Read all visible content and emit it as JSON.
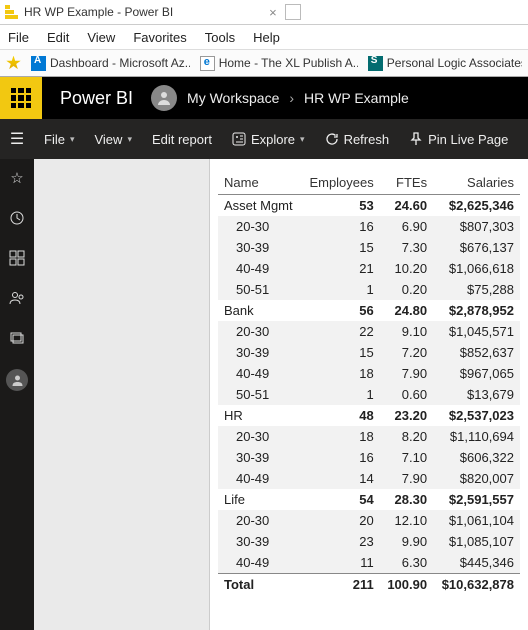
{
  "window": {
    "title": "HR WP Example - Power BI"
  },
  "menu": [
    "File",
    "Edit",
    "View",
    "Favorites",
    "Tools",
    "Help"
  ],
  "favorites": [
    {
      "icon": "azure",
      "label": "Dashboard - Microsoft Az..."
    },
    {
      "icon": "excel",
      "label": "Home - The XL Publish A..."
    },
    {
      "icon": "sharepoint",
      "label": "Personal Logic Associates"
    }
  ],
  "pbi": {
    "product": "Power BI",
    "workspace": "My Workspace",
    "report": "HR WP Example"
  },
  "actions": {
    "file": "File",
    "view": "View",
    "edit": "Edit report",
    "explore": "Explore",
    "refresh": "Refresh",
    "pin": "Pin Live Page"
  },
  "table": {
    "headers": [
      "Name",
      "Employees",
      "FTEs",
      "Salaries"
    ],
    "rows": [
      {
        "t": "g",
        "n": "Asset Mgmt",
        "e": "53",
        "f": "24.60",
        "s": "$2,625,346"
      },
      {
        "t": "s",
        "n": "20-30",
        "e": "16",
        "f": "6.90",
        "s": "$807,303"
      },
      {
        "t": "s",
        "n": "30-39",
        "e": "15",
        "f": "7.30",
        "s": "$676,137"
      },
      {
        "t": "s",
        "n": "40-49",
        "e": "21",
        "f": "10.20",
        "s": "$1,066,618"
      },
      {
        "t": "s",
        "n": "50-51",
        "e": "1",
        "f": "0.20",
        "s": "$75,288"
      },
      {
        "t": "g",
        "n": "Bank",
        "e": "56",
        "f": "24.80",
        "s": "$2,878,952"
      },
      {
        "t": "s",
        "n": "20-30",
        "e": "22",
        "f": "9.10",
        "s": "$1,045,571"
      },
      {
        "t": "s",
        "n": "30-39",
        "e": "15",
        "f": "7.20",
        "s": "$852,637"
      },
      {
        "t": "s",
        "n": "40-49",
        "e": "18",
        "f": "7.90",
        "s": "$967,065"
      },
      {
        "t": "s",
        "n": "50-51",
        "e": "1",
        "f": "0.60",
        "s": "$13,679"
      },
      {
        "t": "g",
        "n": "HR",
        "e": "48",
        "f": "23.20",
        "s": "$2,537,023"
      },
      {
        "t": "s",
        "n": "20-30",
        "e": "18",
        "f": "8.20",
        "s": "$1,110,694"
      },
      {
        "t": "s",
        "n": "30-39",
        "e": "16",
        "f": "7.10",
        "s": "$606,322"
      },
      {
        "t": "s",
        "n": "40-49",
        "e": "14",
        "f": "7.90",
        "s": "$820,007"
      },
      {
        "t": "g",
        "n": "Life",
        "e": "54",
        "f": "28.30",
        "s": "$2,591,557"
      },
      {
        "t": "s",
        "n": "20-30",
        "e": "20",
        "f": "12.10",
        "s": "$1,061,104"
      },
      {
        "t": "s",
        "n": "30-39",
        "e": "23",
        "f": "9.90",
        "s": "$1,085,107"
      },
      {
        "t": "s",
        "n": "40-49",
        "e": "11",
        "f": "6.30",
        "s": "$445,346"
      },
      {
        "t": "t",
        "n": "Total",
        "e": "211",
        "f": "100.90",
        "s": "$10,632,878"
      }
    ]
  }
}
